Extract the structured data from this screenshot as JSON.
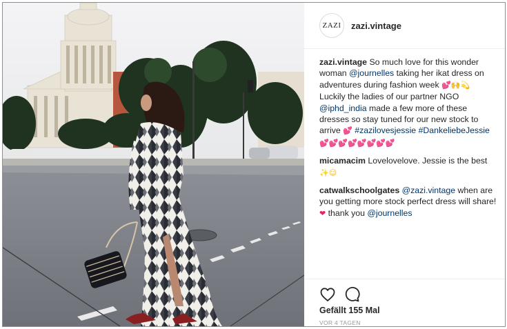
{
  "post": {
    "username": "zazi.vintage",
    "avatar_text": "ZAZI",
    "photo_alt": "Woman in ikat dress crossing the street in front of a domed building"
  },
  "comments": [
    {
      "user": "zazi.vintage",
      "parts": [
        {
          "t": "text",
          "v": " So much love for this wonder woman "
        },
        {
          "t": "mention",
          "v": "@journelles"
        },
        {
          "t": "text",
          "v": " taking her ikat dress on adventures during fashion week "
        },
        {
          "t": "emoji",
          "v": "💕🙌💫",
          "c": "yellow"
        },
        {
          "t": "text",
          "v": " Luckily the ladies of our partner NGO "
        },
        {
          "t": "mention",
          "v": "@iphd_india"
        },
        {
          "t": "text",
          "v": " made a few more of these dresses so stay tuned for our new stock to arrive "
        },
        {
          "t": "emoji",
          "v": "💕",
          "c": "pink"
        },
        {
          "t": "text",
          "v": " "
        },
        {
          "t": "tag",
          "v": "#zazilovesjessie"
        },
        {
          "t": "text",
          "v": " "
        },
        {
          "t": "tag",
          "v": "#DankeliebeJessie"
        },
        {
          "t": "text",
          "v": " "
        },
        {
          "t": "emoji",
          "v": "💕💕💕💕💕💕💕💕",
          "c": "pink"
        }
      ]
    },
    {
      "user": "micamacim",
      "parts": [
        {
          "t": "text",
          "v": " Lovelovelove. Jessie is the best "
        },
        {
          "t": "emoji",
          "v": "✨☺",
          "c": "yellow"
        }
      ]
    },
    {
      "user": "catwalkschoolgates",
      "parts": [
        {
          "t": "text",
          "v": " "
        },
        {
          "t": "mention",
          "v": "@zazi.vintage"
        },
        {
          "t": "text",
          "v": " when are you getting more stock perfect dress will share! "
        },
        {
          "t": "emoji",
          "v": "❤",
          "c": "red"
        },
        {
          "t": "text",
          "v": " thank you "
        },
        {
          "t": "mention",
          "v": "@journelles"
        }
      ]
    }
  ],
  "actions": {
    "likes": "Gefällt 155 Mal",
    "timestamp": "VOR 4 TAGEN"
  },
  "icons": {
    "like": "heart-icon",
    "comment": "speech-bubble-icon"
  },
  "colors": {
    "link": "#003569",
    "border": "#8e8e8e",
    "muted": "#999999"
  }
}
